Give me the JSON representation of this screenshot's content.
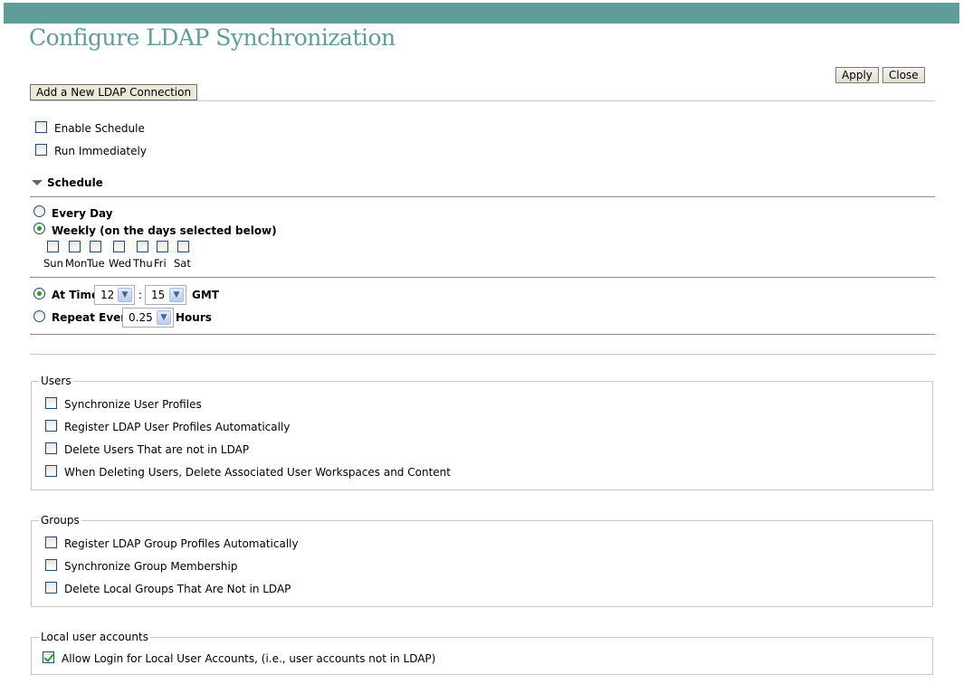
{
  "header": {
    "title": "Configure LDAP Synchronization",
    "apply_label": "Apply",
    "close_label": "Close",
    "add_connection_label": "Add a New LDAP Connection"
  },
  "options": {
    "enable_schedule": {
      "label": "Enable Schedule",
      "checked": false
    },
    "run_immediately": {
      "label": "Run Immediately",
      "checked": false
    }
  },
  "schedule": {
    "heading": "Schedule",
    "every_day_label": "Every Day",
    "weekly_label": "Weekly (on the days selected below)",
    "selected_frequency": "weekly",
    "days": [
      "Sun",
      "Mon",
      "Tue",
      "Wed",
      "Thu",
      "Fri",
      "Sat"
    ],
    "at_time_label": "At Time",
    "hour": "12",
    "separator": ":",
    "minute": "15",
    "timezone": "GMT",
    "repeat_every_label": "Repeat Every",
    "repeat_value": "0.25",
    "repeat_unit": "Hours",
    "selected_time_mode": "at_time"
  },
  "users": {
    "legend": "Users",
    "items": [
      {
        "label": "Synchronize User Profiles",
        "checked": false
      },
      {
        "label": "Register LDAP User Profiles Automatically",
        "checked": false
      },
      {
        "label": "Delete Users That are not in LDAP",
        "checked": false
      },
      {
        "label": "When Deleting Users, Delete Associated User Workspaces and Content",
        "checked": false
      }
    ]
  },
  "groups": {
    "legend": "Groups",
    "items": [
      {
        "label": "Register LDAP Group Profiles Automatically",
        "checked": false
      },
      {
        "label": "Synchronize Group Membership",
        "checked": false
      },
      {
        "label": "Delete Local Groups That Are Not in LDAP",
        "checked": false
      }
    ]
  },
  "local_accounts": {
    "legend": "Local user accounts",
    "items": [
      {
        "label": "Allow Login for Local User Accounts, (i.e., user accounts not in LDAP)",
        "checked": true
      }
    ]
  },
  "colors": {
    "brand": "#5f9e98",
    "checkmark": "#21a121"
  }
}
